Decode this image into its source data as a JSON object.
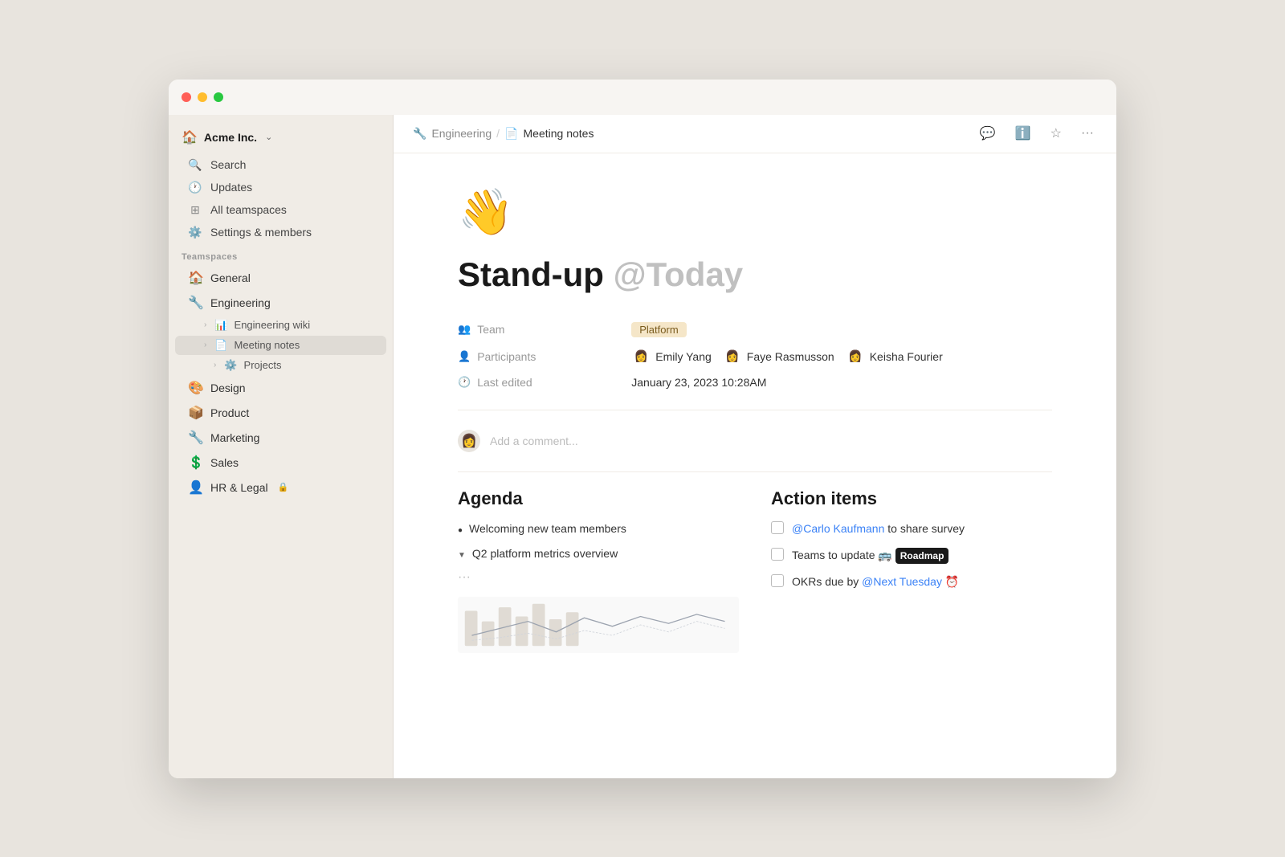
{
  "window": {
    "dots": [
      "red",
      "yellow",
      "green"
    ]
  },
  "sidebar": {
    "workspace": {
      "icon": "🏠",
      "name": "Acme Inc.",
      "chevron": "⌃"
    },
    "nav": [
      {
        "id": "search",
        "icon": "🔍",
        "label": "Search"
      },
      {
        "id": "updates",
        "icon": "🕐",
        "label": "Updates"
      },
      {
        "id": "teamspaces",
        "icon": "⊞",
        "label": "All teamspaces"
      },
      {
        "id": "settings",
        "icon": "⚙️",
        "label": "Settings & members"
      }
    ],
    "teamspaces_label": "Teamspaces",
    "teams": [
      {
        "id": "general",
        "icon": "🏠",
        "label": "General"
      },
      {
        "id": "engineering",
        "icon": "🔧",
        "label": "Engineering"
      }
    ],
    "engineering_sub": [
      {
        "id": "wiki",
        "label": "Engineering wiki",
        "icon": "📊",
        "active": false
      },
      {
        "id": "meeting-notes",
        "label": "Meeting notes",
        "icon": "📄",
        "active": true
      }
    ],
    "projects": {
      "id": "projects",
      "icon": "⚙️",
      "label": "Projects"
    },
    "other_teams": [
      {
        "id": "design",
        "icon": "🎨",
        "label": "Design"
      },
      {
        "id": "product",
        "icon": "📦",
        "label": "Product"
      },
      {
        "id": "marketing",
        "icon": "🔧",
        "label": "Marketing"
      },
      {
        "id": "sales",
        "icon": "💲",
        "label": "Sales"
      },
      {
        "id": "hr",
        "icon": "👤",
        "label": "HR & Legal",
        "lock": true
      }
    ]
  },
  "header": {
    "breadcrumb_workspace": "Engineering",
    "breadcrumb_workspace_icon": "🔧",
    "breadcrumb_page": "Meeting notes",
    "breadcrumb_page_icon": "📄",
    "actions": [
      {
        "id": "comment",
        "icon": "💬"
      },
      {
        "id": "info",
        "icon": "ℹ️"
      },
      {
        "id": "star",
        "icon": "☆"
      },
      {
        "id": "more",
        "icon": "···"
      }
    ]
  },
  "page": {
    "emoji": "👋",
    "title_bold": "Stand-up",
    "title_mention": "@Today",
    "meta": {
      "team_label": "Team",
      "team_value": "Platform",
      "participants_label": "Participants",
      "participants": [
        {
          "name": "Emily Yang",
          "emoji": "👩"
        },
        {
          "name": "Faye Rasmusson",
          "emoji": "👩"
        },
        {
          "name": "Keisha Fourier",
          "emoji": "👩"
        }
      ],
      "last_edited_label": "Last edited",
      "last_edited_value": "January 23, 2023 10:28AM"
    },
    "comment_placeholder": "Add a comment...",
    "agenda": {
      "title": "Agenda",
      "items": [
        {
          "type": "bullet",
          "text": "Welcoming new team members"
        },
        {
          "type": "triangle",
          "text": "Q2 platform metrics overview"
        }
      ]
    },
    "action_items": {
      "title": "Action items",
      "items": [
        {
          "text_before": "",
          "mention": "@Carlo Kaufmann",
          "text_after": " to share survey",
          "checked": false
        },
        {
          "text_before": "Teams to update ",
          "emoji": "🚌",
          "highlight": "Roadmap",
          "text_after": "",
          "checked": false
        },
        {
          "text_before": "OKRs due by ",
          "mention": "@Next Tuesday",
          "clock": "⏰",
          "text_after": "",
          "checked": false
        }
      ]
    }
  }
}
